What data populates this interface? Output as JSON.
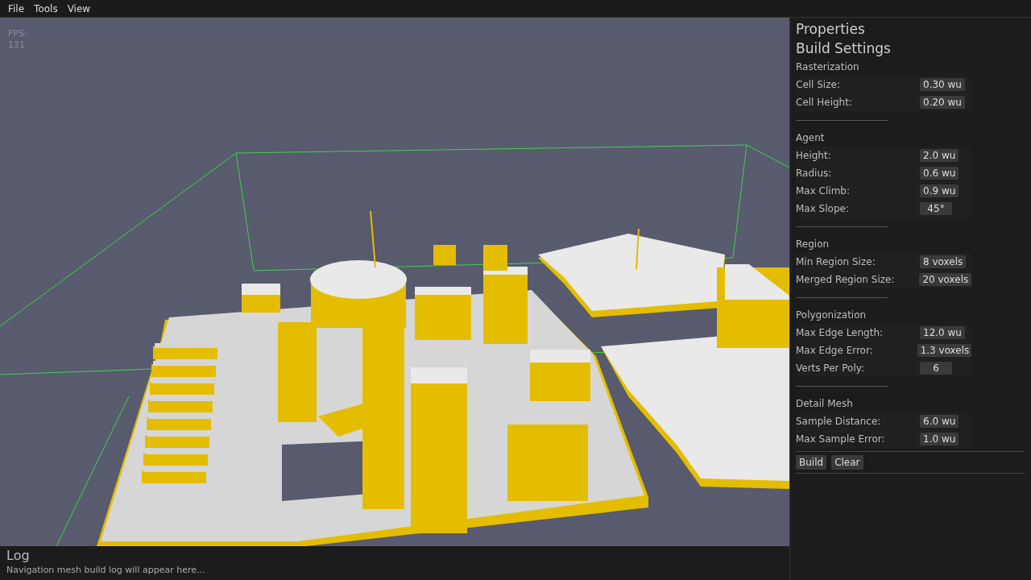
{
  "menu": [
    "File",
    "Tools",
    "View"
  ],
  "viewport": {
    "fps_label": "FPS:",
    "fps_value": "131"
  },
  "properties": {
    "title": "Properties",
    "subtitle": "Build Settings",
    "sections": [
      {
        "title": "Rasterization",
        "rows": [
          {
            "label": "Cell Size:",
            "value": "0.30 wu"
          },
          {
            "label": "Cell Height:",
            "value": "0.20 wu"
          }
        ]
      },
      {
        "title": "Agent",
        "rows": [
          {
            "label": "Height:",
            "value": "2.0 wu"
          },
          {
            "label": "Radius:",
            "value": "0.6 wu"
          },
          {
            "label": "Max Climb:",
            "value": "0.9 wu"
          },
          {
            "label": "Max Slope:",
            "value": "45°"
          }
        ]
      },
      {
        "title": "Region",
        "rows": [
          {
            "label": "Min Region Size:",
            "value": "8 voxels"
          },
          {
            "label": "Merged Region Size:",
            "value": "20 voxels"
          }
        ]
      },
      {
        "title": "Polygonization",
        "rows": [
          {
            "label": "Max Edge Length:",
            "value": "12.0 wu"
          },
          {
            "label": "Max Edge Error:",
            "value": "1.3 voxels"
          },
          {
            "label": "Verts Per Poly:",
            "value": "6"
          }
        ]
      },
      {
        "title": "Detail Mesh",
        "rows": [
          {
            "label": "Sample Distance:",
            "value": "6.0 wu"
          },
          {
            "label": "Max Sample Error:",
            "value": "1.0 wu"
          }
        ]
      }
    ],
    "buttons": [
      "Build",
      "Clear"
    ]
  },
  "log": {
    "title": "Log",
    "message": "Navigation mesh build log will appear here..."
  }
}
